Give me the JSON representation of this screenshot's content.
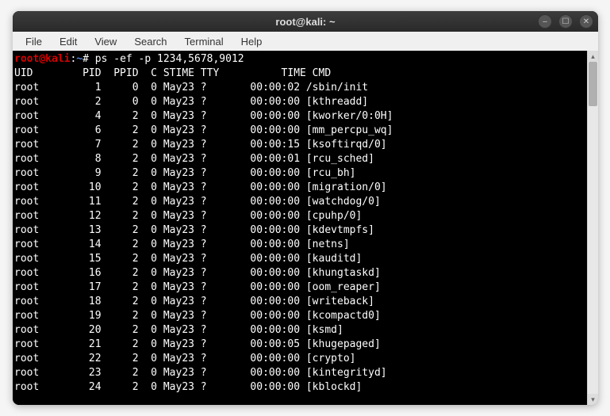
{
  "window": {
    "title": "root@kali: ~"
  },
  "menubar": {
    "items": [
      "File",
      "Edit",
      "View",
      "Search",
      "Terminal",
      "Help"
    ]
  },
  "prompt": {
    "user_host": "root@kali",
    "sep1": ":",
    "path": "~",
    "sep2": "#"
  },
  "command": "ps -ef -p 1234,5678,9012",
  "header": "UID        PID  PPID  C STIME TTY          TIME CMD",
  "rows": [
    {
      "uid": "root",
      "pid": "1",
      "ppid": "0",
      "c": "0",
      "stime": "May23",
      "tty": "?",
      "time": "00:00:02",
      "cmd": "/sbin/init"
    },
    {
      "uid": "root",
      "pid": "2",
      "ppid": "0",
      "c": "0",
      "stime": "May23",
      "tty": "?",
      "time": "00:00:00",
      "cmd": "[kthreadd]"
    },
    {
      "uid": "root",
      "pid": "4",
      "ppid": "2",
      "c": "0",
      "stime": "May23",
      "tty": "?",
      "time": "00:00:00",
      "cmd": "[kworker/0:0H]"
    },
    {
      "uid": "root",
      "pid": "6",
      "ppid": "2",
      "c": "0",
      "stime": "May23",
      "tty": "?",
      "time": "00:00:00",
      "cmd": "[mm_percpu_wq]"
    },
    {
      "uid": "root",
      "pid": "7",
      "ppid": "2",
      "c": "0",
      "stime": "May23",
      "tty": "?",
      "time": "00:00:15",
      "cmd": "[ksoftirqd/0]"
    },
    {
      "uid": "root",
      "pid": "8",
      "ppid": "2",
      "c": "0",
      "stime": "May23",
      "tty": "?",
      "time": "00:00:01",
      "cmd": "[rcu_sched]"
    },
    {
      "uid": "root",
      "pid": "9",
      "ppid": "2",
      "c": "0",
      "stime": "May23",
      "tty": "?",
      "time": "00:00:00",
      "cmd": "[rcu_bh]"
    },
    {
      "uid": "root",
      "pid": "10",
      "ppid": "2",
      "c": "0",
      "stime": "May23",
      "tty": "?",
      "time": "00:00:00",
      "cmd": "[migration/0]"
    },
    {
      "uid": "root",
      "pid": "11",
      "ppid": "2",
      "c": "0",
      "stime": "May23",
      "tty": "?",
      "time": "00:00:00",
      "cmd": "[watchdog/0]"
    },
    {
      "uid": "root",
      "pid": "12",
      "ppid": "2",
      "c": "0",
      "stime": "May23",
      "tty": "?",
      "time": "00:00:00",
      "cmd": "[cpuhp/0]"
    },
    {
      "uid": "root",
      "pid": "13",
      "ppid": "2",
      "c": "0",
      "stime": "May23",
      "tty": "?",
      "time": "00:00:00",
      "cmd": "[kdevtmpfs]"
    },
    {
      "uid": "root",
      "pid": "14",
      "ppid": "2",
      "c": "0",
      "stime": "May23",
      "tty": "?",
      "time": "00:00:00",
      "cmd": "[netns]"
    },
    {
      "uid": "root",
      "pid": "15",
      "ppid": "2",
      "c": "0",
      "stime": "May23",
      "tty": "?",
      "time": "00:00:00",
      "cmd": "[kauditd]"
    },
    {
      "uid": "root",
      "pid": "16",
      "ppid": "2",
      "c": "0",
      "stime": "May23",
      "tty": "?",
      "time": "00:00:00",
      "cmd": "[khungtaskd]"
    },
    {
      "uid": "root",
      "pid": "17",
      "ppid": "2",
      "c": "0",
      "stime": "May23",
      "tty": "?",
      "time": "00:00:00",
      "cmd": "[oom_reaper]"
    },
    {
      "uid": "root",
      "pid": "18",
      "ppid": "2",
      "c": "0",
      "stime": "May23",
      "tty": "?",
      "time": "00:00:00",
      "cmd": "[writeback]"
    },
    {
      "uid": "root",
      "pid": "19",
      "ppid": "2",
      "c": "0",
      "stime": "May23",
      "tty": "?",
      "time": "00:00:00",
      "cmd": "[kcompactd0]"
    },
    {
      "uid": "root",
      "pid": "20",
      "ppid": "2",
      "c": "0",
      "stime": "May23",
      "tty": "?",
      "time": "00:00:00",
      "cmd": "[ksmd]"
    },
    {
      "uid": "root",
      "pid": "21",
      "ppid": "2",
      "c": "0",
      "stime": "May23",
      "tty": "?",
      "time": "00:00:05",
      "cmd": "[khugepaged]"
    },
    {
      "uid": "root",
      "pid": "22",
      "ppid": "2",
      "c": "0",
      "stime": "May23",
      "tty": "?",
      "time": "00:00:00",
      "cmd": "[crypto]"
    },
    {
      "uid": "root",
      "pid": "23",
      "ppid": "2",
      "c": "0",
      "stime": "May23",
      "tty": "?",
      "time": "00:00:00",
      "cmd": "[kintegrityd]"
    },
    {
      "uid": "root",
      "pid": "24",
      "ppid": "2",
      "c": "0",
      "stime": "May23",
      "tty": "?",
      "time": "00:00:00",
      "cmd": "[kblockd]"
    }
  ]
}
